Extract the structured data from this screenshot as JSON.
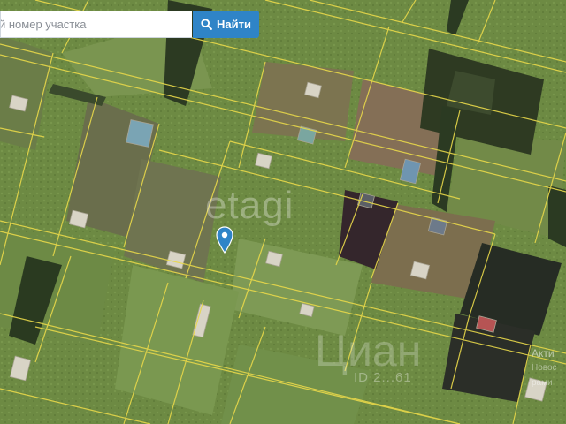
{
  "search": {
    "placeholder": "й номер участка",
    "button_label": "Найти",
    "button_icon": "search-icon"
  },
  "watermarks": {
    "etagi": "etagi",
    "cian": "Циан",
    "listing_id": "ID 2...61"
  },
  "agency": {
    "name": "Акти",
    "line2": "Новос",
    "line3": "рами"
  },
  "marker": {
    "icon": "map-pin-icon",
    "color": "#2f84c7"
  },
  "colors": {
    "parcel_border": "#e8d84a",
    "button": "#2f84c7"
  }
}
